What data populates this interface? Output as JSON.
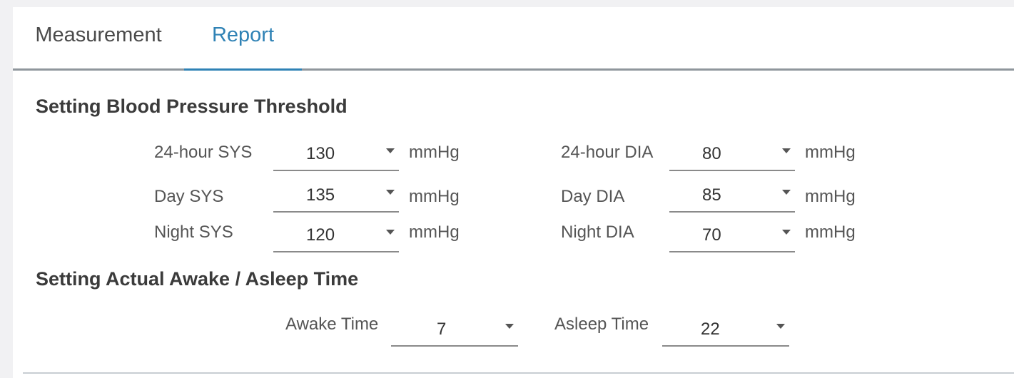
{
  "tabs": [
    {
      "label": "Measurement",
      "active": false
    },
    {
      "label": "Report",
      "active": true
    }
  ],
  "bp_section": {
    "title": "Setting Blood Pressure Threshold",
    "rows": [
      {
        "left": {
          "label": "24-hour SYS",
          "value": "130",
          "unit": "mmHg"
        },
        "right": {
          "label": "24-hour DIA",
          "value": "80",
          "unit": "mmHg"
        }
      },
      {
        "left": {
          "label": "Day SYS",
          "value": "135",
          "unit": "mmHg"
        },
        "right": {
          "label": "Day DIA",
          "value": "85",
          "unit": "mmHg"
        }
      },
      {
        "left": {
          "label": "Night SYS",
          "value": "120",
          "unit": "mmHg"
        },
        "right": {
          "label": "Night DIA",
          "value": "70",
          "unit": "mmHg"
        }
      }
    ]
  },
  "time_section": {
    "title": "Setting Actual Awake / Asleep Time",
    "awake": {
      "label": "Awake Time",
      "value": "7"
    },
    "asleep": {
      "label": "Asleep Time",
      "value": "22"
    }
  },
  "colors": {
    "accent": "#2f82b5",
    "tab_underline": "#8f969c",
    "text": "#3b3b3b"
  },
  "icons": {
    "dropdown": "caret-down-icon"
  }
}
